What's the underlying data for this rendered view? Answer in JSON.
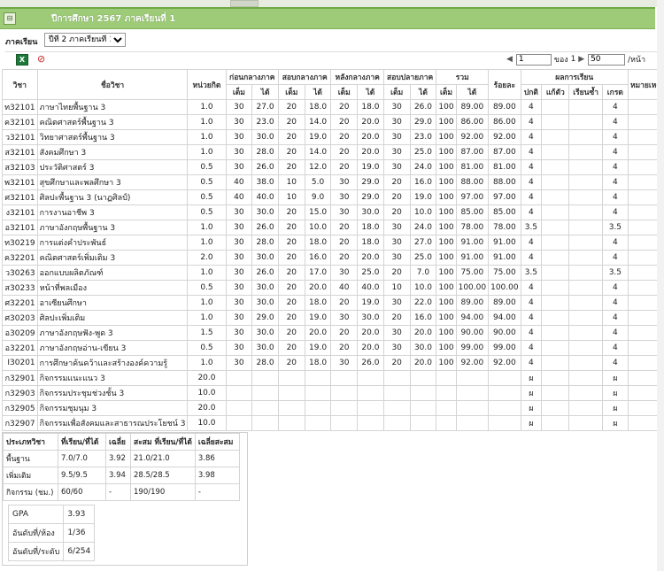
{
  "titlebar": {
    "collapse_icon": "⊟",
    "title": "ปีการศึกษา 2567 ภาคเรียนที่ 1"
  },
  "semester": {
    "label": "ภาคเรียน",
    "selected": "ปีที่ 2 ภาคเรียนที่ 1"
  },
  "toolbar": {
    "excel_icon": "excel-icon",
    "filter_icon": "clear-filter-icon"
  },
  "pager": {
    "page": "1",
    "of_label": "ของ",
    "total": "1",
    "page_size": "50",
    "per_page_label": "/หน้า"
  },
  "table": {
    "headers": {
      "code": "วิชา",
      "name": "ชื่อวิชา",
      "credit": "หน่วยกิต",
      "g1": "ก่อนกลางภาค",
      "g2": "สอบกลางภาค",
      "g3": "หลังกลางภาค",
      "g4": "สอบปลายภาค",
      "g5": "รวม",
      "percent": "ร้อยละ",
      "result": "ผลการเรียน",
      "remark": "หมายเหตุ",
      "full": "เต็ม",
      "got": "ได้",
      "normal": "ปกติ",
      "fix": "แก้ตัว",
      "repeat": "เรียนซ้ำ",
      "grade": "เกรด"
    },
    "rows": [
      [
        "ท32101",
        "ภาษาไทยพื้นฐาน 3",
        "1.0",
        "30",
        "27.0",
        "20",
        "18.0",
        "20",
        "18.0",
        "30",
        "26.0",
        "100",
        "89.00",
        "89.00",
        "4",
        "",
        "",
        "4",
        ""
      ],
      [
        "ค32101",
        "คณิตศาสตร์พื้นฐาน 3",
        "1.0",
        "30",
        "23.0",
        "20",
        "14.0",
        "20",
        "20.0",
        "30",
        "29.0",
        "100",
        "86.00",
        "86.00",
        "4",
        "",
        "",
        "4",
        ""
      ],
      [
        "ว32101",
        "วิทยาศาสตร์พื้นฐาน 3",
        "1.0",
        "30",
        "30.0",
        "20",
        "19.0",
        "20",
        "20.0",
        "30",
        "23.0",
        "100",
        "92.00",
        "92.00",
        "4",
        "",
        "",
        "4",
        ""
      ],
      [
        "ส32101",
        "สังคมศึกษา 3",
        "1.0",
        "30",
        "28.0",
        "20",
        "14.0",
        "20",
        "20.0",
        "30",
        "25.0",
        "100",
        "87.00",
        "87.00",
        "4",
        "",
        "",
        "4",
        ""
      ],
      [
        "ส32103",
        "ประวัติศาสตร์ 3",
        "0.5",
        "30",
        "26.0",
        "20",
        "12.0",
        "20",
        "19.0",
        "30",
        "24.0",
        "100",
        "81.00",
        "81.00",
        "4",
        "",
        "",
        "4",
        ""
      ],
      [
        "พ32101",
        "สุขศึกษาและพลศึกษา 3",
        "0.5",
        "40",
        "38.0",
        "10",
        "5.0",
        "30",
        "29.0",
        "20",
        "16.0",
        "100",
        "88.00",
        "88.00",
        "4",
        "",
        "",
        "4",
        ""
      ],
      [
        "ศ32101",
        "ศิลปะพื้นฐาน 3 (นาฏศิลป์)",
        "0.5",
        "40",
        "40.0",
        "10",
        "9.0",
        "30",
        "29.0",
        "20",
        "19.0",
        "100",
        "97.00",
        "97.00",
        "4",
        "",
        "",
        "4",
        ""
      ],
      [
        "ง32101",
        "การงานอาชีพ 3",
        "0.5",
        "30",
        "30.0",
        "20",
        "15.0",
        "30",
        "30.0",
        "20",
        "10.0",
        "100",
        "85.00",
        "85.00",
        "4",
        "",
        "",
        "4",
        ""
      ],
      [
        "อ32101",
        "ภาษาอังกฤษพื้นฐาน 3",
        "1.0",
        "30",
        "26.0",
        "20",
        "10.0",
        "20",
        "18.0",
        "30",
        "24.0",
        "100",
        "78.00",
        "78.00",
        "3.5",
        "",
        "",
        "3.5",
        ""
      ],
      [
        "ท30219",
        "การแต่งคำประพันธ์",
        "1.0",
        "30",
        "28.0",
        "20",
        "18.0",
        "20",
        "18.0",
        "30",
        "27.0",
        "100",
        "91.00",
        "91.00",
        "4",
        "",
        "",
        "4",
        ""
      ],
      [
        "ค32201",
        "คณิตศาสตร์เพิ่มเติม 3",
        "2.0",
        "30",
        "30.0",
        "20",
        "16.0",
        "20",
        "20.0",
        "30",
        "25.0",
        "100",
        "91.00",
        "91.00",
        "4",
        "",
        "",
        "4",
        ""
      ],
      [
        "ว30263",
        "ออกแบบผลิตภัณฑ์",
        "1.0",
        "30",
        "26.0",
        "20",
        "17.0",
        "30",
        "25.0",
        "20",
        "7.0",
        "100",
        "75.00",
        "75.00",
        "3.5",
        "",
        "",
        "3.5",
        ""
      ],
      [
        "ส30233",
        "หน้าที่พลเมือง",
        "0.5",
        "30",
        "30.0",
        "20",
        "20.0",
        "40",
        "40.0",
        "10",
        "10.0",
        "100",
        "100.00",
        "100.00",
        "4",
        "",
        "",
        "4",
        ""
      ],
      [
        "ศ32201",
        "อาเซียนศึกษา",
        "1.0",
        "30",
        "30.0",
        "20",
        "18.0",
        "20",
        "19.0",
        "30",
        "22.0",
        "100",
        "89.00",
        "89.00",
        "4",
        "",
        "",
        "4",
        ""
      ],
      [
        "ศ30203",
        "ศิลปะเพิ่มเติม",
        "1.0",
        "30",
        "29.0",
        "20",
        "19.0",
        "30",
        "30.0",
        "20",
        "16.0",
        "100",
        "94.00",
        "94.00",
        "4",
        "",
        "",
        "4",
        ""
      ],
      [
        "อ30209",
        "ภาษาอังกฤษฟัง-พูด 3",
        "1.5",
        "30",
        "30.0",
        "20",
        "20.0",
        "20",
        "20.0",
        "30",
        "20.0",
        "100",
        "90.00",
        "90.00",
        "4",
        "",
        "",
        "4",
        ""
      ],
      [
        "อ32201",
        "ภาษาอังกฤษอ่าน-เขียน 3",
        "0.5",
        "30",
        "30.0",
        "20",
        "19.0",
        "20",
        "20.0",
        "30",
        "30.0",
        "100",
        "99.00",
        "99.00",
        "4",
        "",
        "",
        "4",
        ""
      ],
      [
        "I30201",
        "การศึกษาค้นคว้าและสร้างองค์ความรู้",
        "1.0",
        "30",
        "28.0",
        "20",
        "18.0",
        "30",
        "26.0",
        "20",
        "20.0",
        "100",
        "92.00",
        "92.00",
        "4",
        "",
        "",
        "4",
        ""
      ],
      [
        "ก32901",
        "กิจกรรมแนะแนว 3",
        "20.0",
        "",
        "",
        "",
        "",
        "",
        "",
        "",
        "",
        "",
        "",
        "",
        "ผ",
        "",
        "",
        "ผ",
        ""
      ],
      [
        "ก32903",
        "กิจกรรมประชุมช่วงชั้น 3",
        "10.0",
        "",
        "",
        "",
        "",
        "",
        "",
        "",
        "",
        "",
        "",
        "",
        "ผ",
        "",
        "",
        "ผ",
        ""
      ],
      [
        "ก32905",
        "กิจกรรมชุมนุม 3",
        "20.0",
        "",
        "",
        "",
        "",
        "",
        "",
        "",
        "",
        "",
        "",
        "",
        "ผ",
        "",
        "",
        "ผ",
        ""
      ],
      [
        "ก32907",
        "กิจกรรมเพื่อสังคมและสาธารณประโยชน์ 3",
        "10.0",
        "",
        "",
        "",
        "",
        "",
        "",
        "",
        "",
        "",
        "",
        "",
        "ผ",
        "",
        "",
        "ผ",
        ""
      ]
    ]
  },
  "summary": {
    "headers": [
      "ประเภทวิชา",
      "ที่เรียน/ที่ได้",
      "เฉลี่ย",
      "สะสม ที่เรียน/ที่ได้",
      "เฉลี่ยสะสม"
    ],
    "rows": [
      [
        "พื้นฐาน",
        "7.0/7.0",
        "3.92",
        "21.0/21.0",
        "3.86"
      ],
      [
        "เพิ่มเติม",
        "9.5/9.5",
        "3.94",
        "28.5/28.5",
        "3.98"
      ],
      [
        "กิจกรรม (ชม.)",
        "60/60",
        "-",
        "190/190",
        "-"
      ]
    ],
    "gpa_label": "GPA",
    "gpa": "3.93",
    "rank_room_label": "อันดับที่/ห้อง",
    "rank_room": "1/36",
    "rank_level_label": "อันดับที่/ระดับ",
    "rank_level": "6/254"
  }
}
